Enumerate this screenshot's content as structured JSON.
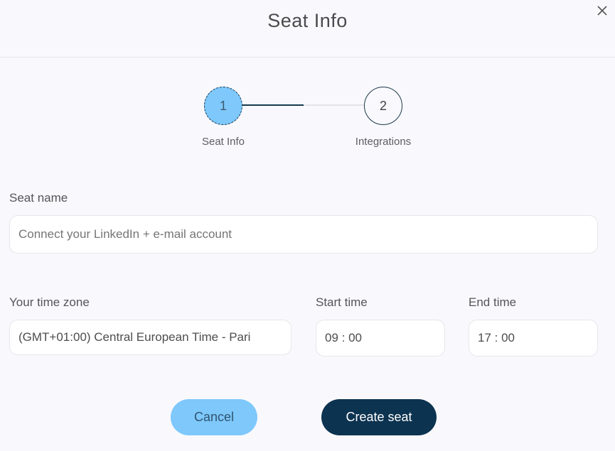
{
  "dialog": {
    "title": "Seat Info",
    "close_icon": "close-icon"
  },
  "stepper": {
    "steps": [
      {
        "number": "1",
        "label": "Seat Info",
        "state": "active"
      },
      {
        "number": "2",
        "label": "Integrations",
        "state": "pending"
      }
    ]
  },
  "form": {
    "seat_name": {
      "label": "Seat name",
      "placeholder": "Connect your LinkedIn + e-mail account",
      "value": ""
    },
    "time_zone": {
      "label": "Your time zone",
      "value": "(GMT+01:00) Central European Time - Pari"
    },
    "start_time": {
      "label": "Start time",
      "value": "09 : 00"
    },
    "end_time": {
      "label": "End time",
      "value": "17 : 00"
    }
  },
  "actions": {
    "cancel_label": "Cancel",
    "create_label": "Create seat"
  },
  "colors": {
    "primary_dark": "#0c3350",
    "accent_light": "#7ec8fb"
  }
}
